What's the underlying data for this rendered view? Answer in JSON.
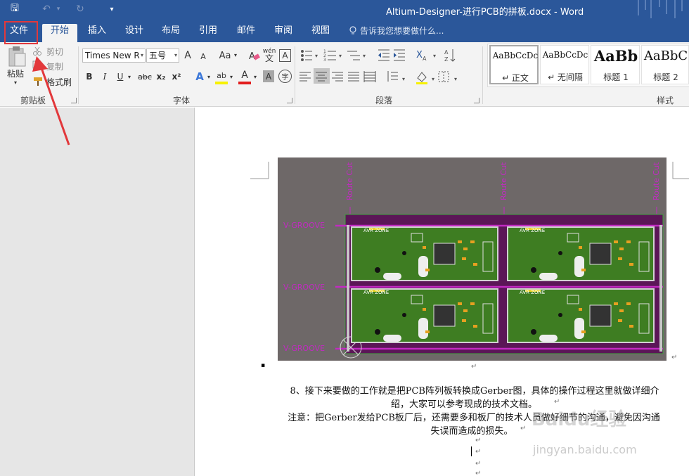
{
  "window": {
    "title": "Altium-Designer-进行PCB的拼板.docx - Word"
  },
  "qat": {
    "save": "🖫",
    "undo": "↶",
    "undo_menu": "▾",
    "redo": "↻",
    "customize": "▾"
  },
  "tabs": [
    {
      "label": "文件"
    },
    {
      "label": "开始"
    },
    {
      "label": "插入"
    },
    {
      "label": "设计"
    },
    {
      "label": "布局"
    },
    {
      "label": "引用"
    },
    {
      "label": "邮件"
    },
    {
      "label": "审阅"
    },
    {
      "label": "视图"
    }
  ],
  "tell_me": {
    "text": "告诉我您想要做什么..."
  },
  "clipboard": {
    "paste": "粘贴",
    "cut": "剪切",
    "copy": "复制",
    "format_painter": "格式刷",
    "group": "剪贴板"
  },
  "font": {
    "name": "Times New R",
    "size": "五号",
    "grow": "A",
    "shrink": "A",
    "case": "Aa",
    "clear": "A",
    "phonetic": "wén",
    "border_char": "A",
    "bold": "B",
    "italic": "I",
    "underline": "U",
    "strike": "abc",
    "sub": "x₂",
    "sup": "x²",
    "effects": "A",
    "highlight": "ab",
    "color": "A",
    "shade": "A",
    "enclose": "字",
    "group": "字体"
  },
  "paragraph": {
    "group": "段落"
  },
  "styles": {
    "items": [
      {
        "preview": "AaBbCcDc",
        "name": "↵ 正文"
      },
      {
        "preview": "AaBbCcDc",
        "name": "↵ 无间隔"
      },
      {
        "preview": "AaBb",
        "name": "标题 1"
      },
      {
        "preview": "AaBbC",
        "name": "标题 2"
      }
    ],
    "group": "样式"
  },
  "figure": {
    "route_cut": "Route Cut",
    "vgroove": "V-GROOVE",
    "board_labels": [
      "AVR ZONE",
      "AVR ZONE",
      "AVR ZONE",
      "AVR ZONE"
    ]
  },
  "body": {
    "bullet": "▪",
    "line1": "8、接下来要做的工作就是把PCB阵列板转换成Gerber图，具体的操作过程这里就做详细介",
    "line2": "绍，大家可以参考现成的技术文档。",
    "line3": "注意：把Gerber发给PCB板厂后，还需要多和板厂的技术人员做好细节的沟通，避免因沟通",
    "line4": "失误而造成的损失。",
    "mark": "↵"
  },
  "watermark": {
    "brand": "Baidu经验",
    "url": "jingyan.baidu.com"
  },
  "colors": {
    "ribbon_blue": "#2b579a",
    "callout_red": "#e2383b",
    "pcb_green": "#3e7d22",
    "route_magenta": "#c22ac2"
  }
}
